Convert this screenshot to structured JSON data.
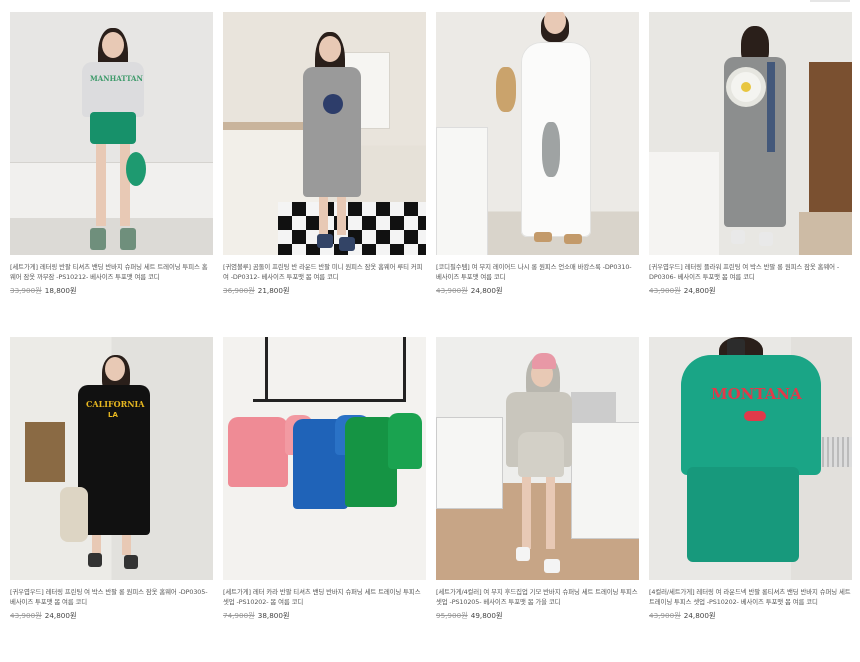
{
  "products": [
    {
      "title": "[세트가게] 레터링 반팔 티셔츠 밴딩 반바지 슈퍼닝 세트 트레이닝 투피스 홈웨어 잠옷 까무잠 -PS10212- 베사이즈 투포맷 여름 코디",
      "price_original": "33,900원",
      "price_sale": "18,800원",
      "image_desc": "woman-in-gray-tee-green-shorts"
    },
    {
      "title": "[귀염볼루] 곰돌이 프린팅 반 라운드 반팔 미니 원피스 잠옷 홈웨어 루티 커피여 -DP0312- 베사이즈 투포맷 봄 여름 코디",
      "price_original": "36,900원",
      "price_sale": "21,800원",
      "image_desc": "woman-in-gray-bear-dress-kitchen"
    },
    {
      "title": "[코디필수템] 여 무지 레이어드 나시 롱 원피스 언소매 바캉스룩 -DP0310- 베사이즈 투포맷 여름 코디",
      "price_original": "43,900원",
      "price_sale": "24,800원",
      "image_desc": "woman-in-white-sleeveless-maxi-dress"
    },
    {
      "title": "[귀우엽우드] 레터링 플라워 프린팅 여 박스 반팔 롱 원피스 잠옷 홈웨어 -DP0306- 베사이즈 투포맷 봄 여름 코디",
      "price_original": "43,900원",
      "price_sale": "24,800원",
      "image_desc": "woman-in-gray-daisy-long-dress-back-view"
    },
    {
      "title": "[귀우엽우드] 레터링 프린팅 여 박스 반팔 롱 원피스 잠옷 홈웨어 -DP0305- 베사이즈 투포맷 봄 여름 코디",
      "price_original": "43,900원",
      "price_sale": "24,800원",
      "image_desc": "woman-in-black-california-long-dress"
    },
    {
      "title": "[세트가게] 레터 카라 반팔 티셔츠 밴딩 반바지 슈퍼닝 세트 트레이닝 투피스 셋업 -PS10202- 봄 여름 코디",
      "price_original": "74,900원",
      "price_sale": "38,800원",
      "image_desc": "collar-sets-on-clothes-rack"
    },
    {
      "title": "[세트가게/4컬러] 여 무지 후드집업 기모 반바지 슈퍼닝 세트 트레이닝 투피스 셋업 -PS10205- 베사이즈 투포맷 봄 가을 코디",
      "price_original": "95,900원",
      "price_sale": "49,800원",
      "image_desc": "woman-in-hoodie-set-with-pink-cap"
    },
    {
      "title": "[4컬러/세트가게] 레터링 여 라운드넥 반팔 롱티셔츠 밴딩 반바지 슈퍼닝 세트 트레이닝 투피스 셋업 -PS10202- 베사이즈 투포맷 봄 여름 코디",
      "price_original": "43,900원",
      "price_sale": "24,800원",
      "image_desc": "woman-in-green-montana-set"
    }
  ],
  "colors": {
    "price_original": "#9a9a9a",
    "price_sale": "#444444",
    "title_text": "#555555"
  }
}
